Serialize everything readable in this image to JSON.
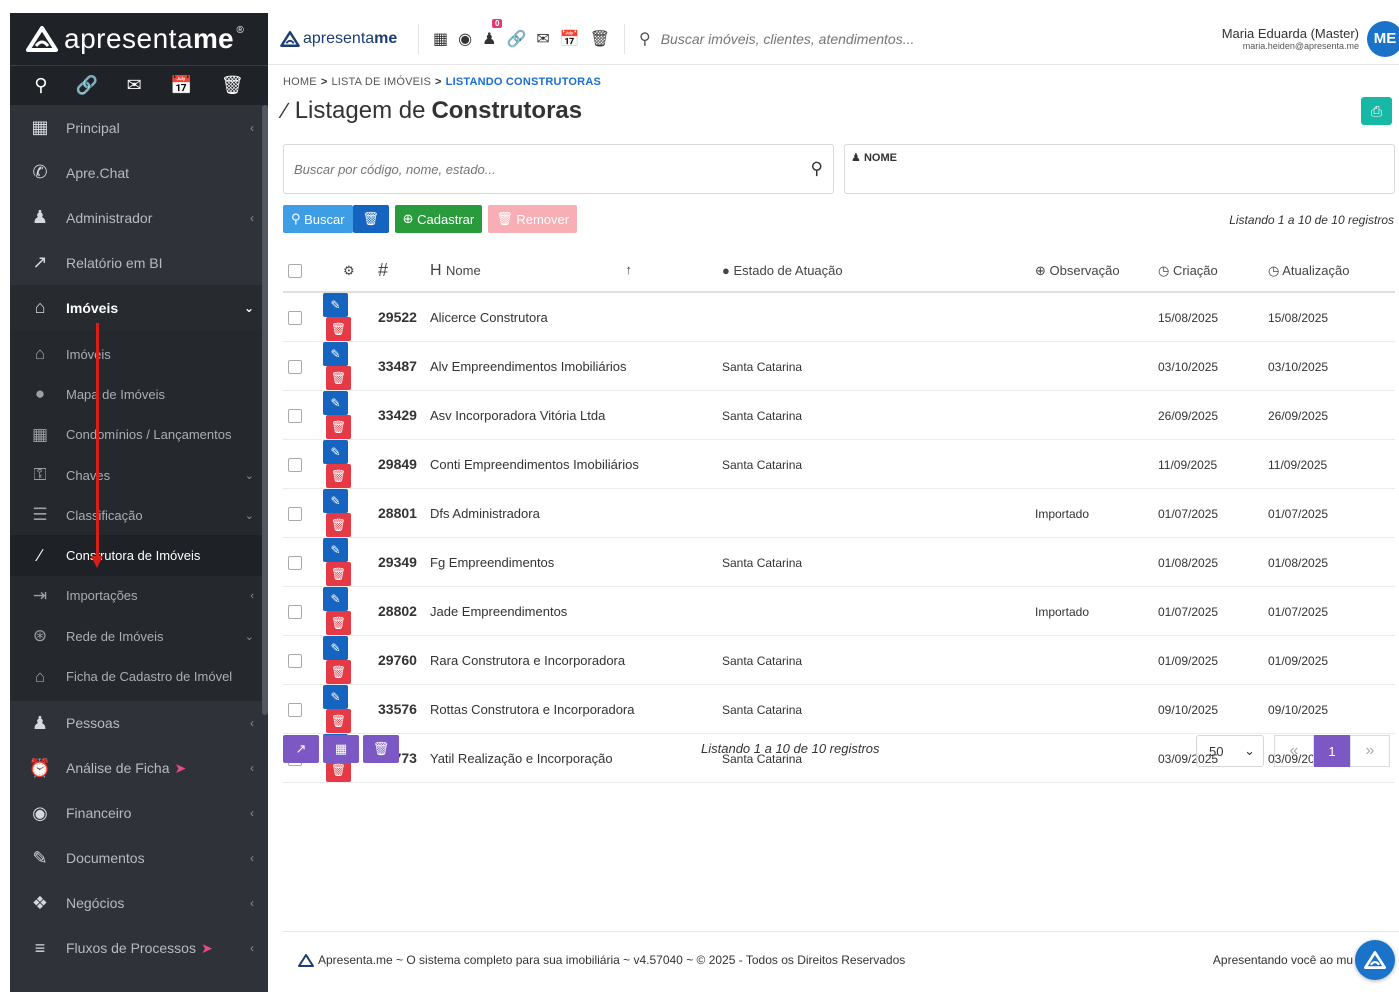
{
  "brand": {
    "part1": "apresenta",
    "part2": "me",
    "reg": "®"
  },
  "topbar": {
    "logo_part1": "apresenta",
    "logo_part2": "me",
    "badge": "0",
    "search_placeholder": "Buscar imóveis, clientes, atendimentos...",
    "user_name": "Maria Eduarda (Master)",
    "user_email": "maria.heiden@apresenta.me",
    "avatar": "ME"
  },
  "sidebar": {
    "menu_top": [
      {
        "label": "Principal",
        "icon": "grid-icon"
      },
      {
        "label": "Apre.Chat",
        "icon": "whatsapp-icon"
      },
      {
        "label": "Administrador",
        "icon": "admin-icon"
      },
      {
        "label": "Relatório em BI",
        "icon": "chart-icon"
      },
      {
        "label": "Imóveis",
        "icon": "home-icon"
      }
    ],
    "submenu": [
      {
        "label": "Imóveis",
        "icon": "home-icon"
      },
      {
        "label": "Mapa de Imóveis",
        "icon": "map-pin-icon"
      },
      {
        "label": "Condomínios / Lançamentos",
        "icon": "building-icon"
      },
      {
        "label": "Chaves",
        "icon": "key-icon"
      },
      {
        "label": "Classificação",
        "icon": "sitemap-icon"
      },
      {
        "label": "Construtora de Imóveis",
        "icon": "trowel-icon"
      },
      {
        "label": "Importações",
        "icon": "import-icon"
      },
      {
        "label": "Rede de Imóveis",
        "icon": "network-icon"
      },
      {
        "label": "Ficha de Cadastro de Imóvel",
        "icon": "home-icon"
      }
    ],
    "menu_bottom": [
      {
        "label": "Pessoas",
        "icon": "people-icon"
      },
      {
        "label": "Análise de Ficha",
        "icon": "alarm-icon"
      },
      {
        "label": "Financeiro",
        "icon": "dollar-icon"
      },
      {
        "label": "Documentos",
        "icon": "document-edit-icon"
      },
      {
        "label": "Negócios",
        "icon": "handshake-icon"
      },
      {
        "label": "Fluxos de Processos",
        "icon": "filter-icon"
      }
    ]
  },
  "breadcrumb": {
    "home": "HOME",
    "list": "LISTA DE IMÓVEIS",
    "current": "LISTANDO CONSTRUTORAS"
  },
  "page": {
    "title_light": "Listagem de",
    "title_bold": "Construtoras"
  },
  "search": {
    "placeholder": "Buscar por código, nome, estado...",
    "nome_label": "NOME"
  },
  "actions": {
    "buscar": "Buscar",
    "cadastrar": "Cadastrar",
    "remover": "Remover"
  },
  "listing_text": "Listando 1 a 10 de 10 registros",
  "table": {
    "headers": {
      "id": "#",
      "nome": "Nome",
      "estado": "Estado de Atuação",
      "obs": "Observação",
      "criacao": "Criação",
      "atualizacao": "Atualização"
    },
    "rows": [
      {
        "code": "29522",
        "name": "Alicerce Construtora",
        "estado": "",
        "obs": "",
        "criacao": "15/08/2025",
        "atualizacao": "15/08/2025"
      },
      {
        "code": "33487",
        "name": "Alv Empreendimentos Imobiliários",
        "estado": "Santa Catarina",
        "obs": "",
        "criacao": "03/10/2025",
        "atualizacao": "03/10/2025"
      },
      {
        "code": "33429",
        "name": "Asv Incorporadora Vitória Ltda",
        "estado": "Santa Catarina",
        "obs": "",
        "criacao": "26/09/2025",
        "atualizacao": "26/09/2025"
      },
      {
        "code": "29849",
        "name": "Conti Empreendimentos Imobiliários",
        "estado": "Santa Catarina",
        "obs": "",
        "criacao": "11/09/2025",
        "atualizacao": "11/09/2025"
      },
      {
        "code": "28801",
        "name": "Dfs Administradora",
        "estado": "",
        "obs": "Importado",
        "criacao": "01/07/2025",
        "atualizacao": "01/07/2025"
      },
      {
        "code": "29349",
        "name": "Fg Empreendimentos",
        "estado": "Santa Catarina",
        "obs": "",
        "criacao": "01/08/2025",
        "atualizacao": "01/08/2025"
      },
      {
        "code": "28802",
        "name": "Jade Empreendimentos",
        "estado": "",
        "obs": "Importado",
        "criacao": "01/07/2025",
        "atualizacao": "01/07/2025"
      },
      {
        "code": "29760",
        "name": "Rara Construtora e Incorporadora",
        "estado": "Santa Catarina",
        "obs": "",
        "criacao": "01/09/2025",
        "atualizacao": "01/09/2025"
      },
      {
        "code": "33576",
        "name": "Rottas Construtora e Incorporadora",
        "estado": "Santa Catarina",
        "obs": "",
        "criacao": "09/10/2025",
        "atualizacao": "09/10/2025"
      },
      {
        "code": "29773",
        "name": "Yatil Realização e Incorporação",
        "estado": "Santa Catarina",
        "obs": "",
        "criacao": "03/09/2025",
        "atualizacao": "03/09/2025"
      }
    ]
  },
  "pagination": {
    "per_page": "50",
    "current": "1",
    "first": "«",
    "last": "»"
  },
  "footer": {
    "left": "Apresenta.me ~ O sistema completo para sua imobiliária ~ v4.57040 ~ © 2025 - Todos os Direitos Reservados",
    "right": "Apresentando você ao mu"
  }
}
